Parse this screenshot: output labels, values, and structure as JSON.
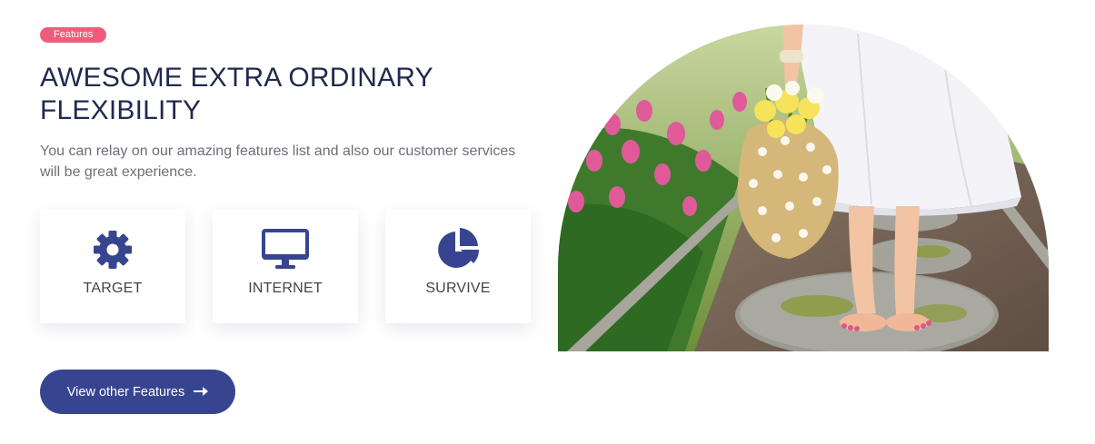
{
  "badge": "Features",
  "title": "AWESOME EXTRA ORDINARY FLEXIBILITY",
  "description": "You can relay on our amazing features list and also our customer services will be great experience.",
  "features": [
    {
      "label": "TARGET",
      "icon": "gear-icon"
    },
    {
      "label": "INTERNET",
      "icon": "monitor-icon"
    },
    {
      "label": "SURVIVE",
      "icon": "pie-chart-icon"
    }
  ],
  "cta": {
    "label": "View other Features",
    "icon": "arrow-right-icon"
  },
  "colors": {
    "accent": "#374591",
    "badge": "#f25c7c",
    "heading": "#1f2a4e"
  }
}
